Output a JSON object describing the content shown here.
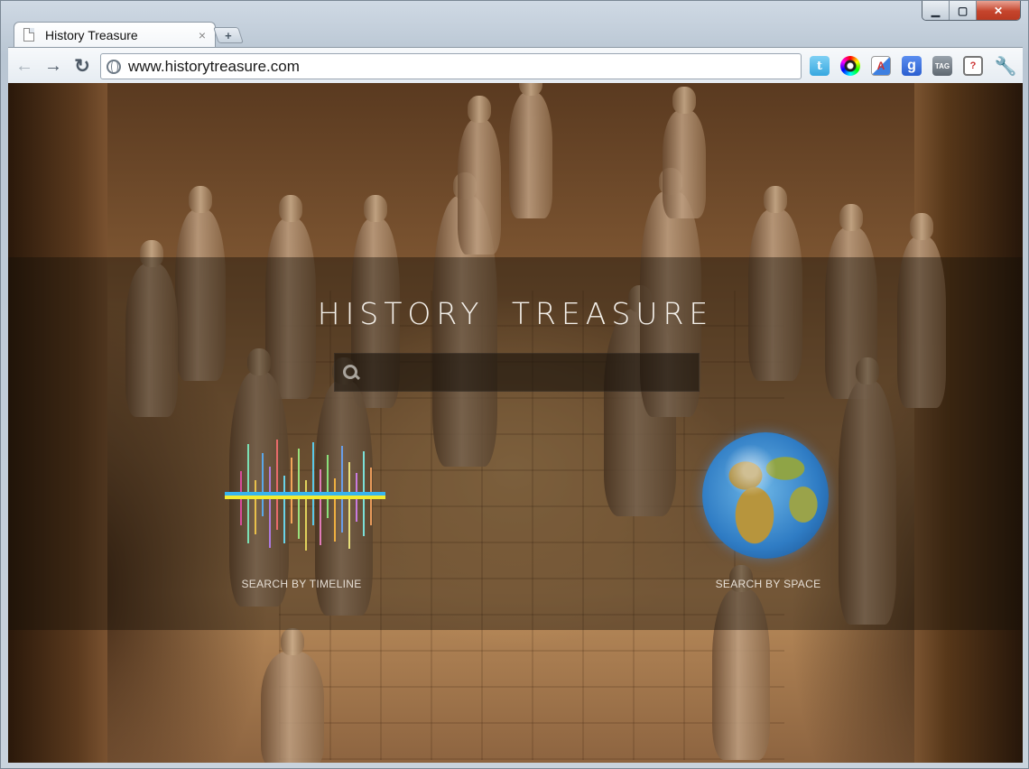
{
  "window": {
    "minimize_glyph": "▁",
    "maximize_glyph": "▢",
    "close_glyph": "✕"
  },
  "tab": {
    "title": "History Treasure",
    "close_glyph": "×",
    "new_tab_glyph": "+"
  },
  "toolbar": {
    "back_glyph": "←",
    "forward_glyph": "→",
    "reload_glyph": "↻",
    "url": "www.historytreasure.com",
    "extensions": [
      {
        "name": "twitter-icon",
        "glyph": "t"
      },
      {
        "name": "color-picker-icon",
        "glyph": ""
      },
      {
        "name": "translate-icon",
        "glyph": "A"
      },
      {
        "name": "google-icon",
        "glyph": "g"
      },
      {
        "name": "tag-icon",
        "glyph": "TAG"
      },
      {
        "name": "mail-checker-icon",
        "glyph": "?"
      },
      {
        "name": "wrench-icon",
        "glyph": "🔧"
      }
    ]
  },
  "page": {
    "site_title": "HISTORY TREASURE",
    "search_placeholder": "",
    "timeline_label": "SEARCH BY TIMELINE",
    "space_label": "SEARCH BY SPACE"
  }
}
